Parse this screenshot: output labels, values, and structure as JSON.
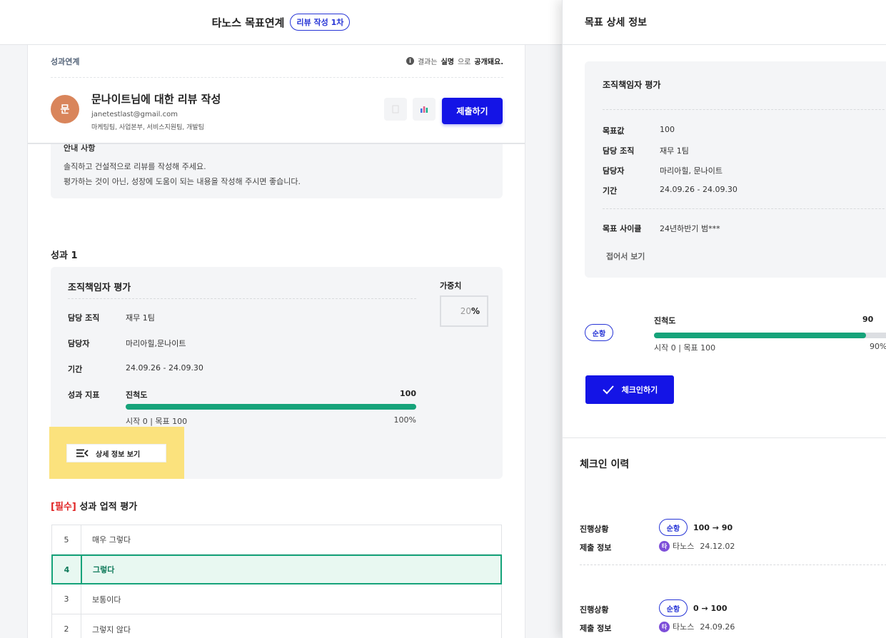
{
  "header": {
    "title": "타노스 목표연계",
    "badge": "리뷰 작성 1차"
  },
  "review": {
    "crumb": "성과연계",
    "notice_pre": "결과는",
    "notice_bold1": "실명",
    "notice_mid": "으로",
    "notice_bold2": "공개돼요.",
    "avatar": "문",
    "title": "문나이트님에 대한 리뷰 작성",
    "email": "janetestlast@gmail.com",
    "teams": "마케팅팀, 사업본부, 서비스지원팀, 개발팀",
    "submit_label": "제출하기"
  },
  "guide": {
    "title": "안내 사항",
    "lines": [
      "솔직하고 건설적으로 리뷰를 작성해 주세요.",
      "평가하는 것이 아닌, 성장에 도움이 되는 내용을 작성해 주시면 좋습니다."
    ]
  },
  "perf": {
    "section": "성과 1",
    "card_title": "조직책임자 평가",
    "weight_label": "가중치",
    "weight_value": "20",
    "weight_unit": "%",
    "rows": [
      {
        "key": "담당 조직",
        "value": "재무 1팀"
      },
      {
        "key": "담당자",
        "value": "마리아힐,문나이트"
      },
      {
        "key": "기간",
        "value": "24.09.26 - 24.09.30"
      }
    ],
    "metric_key": "성과 지표",
    "metric_name": "진척도",
    "metric_value": "100",
    "metric_progress": 1.0,
    "metric_sub": "시작 0 | 목표 100",
    "metric_pct": "100%",
    "detail_btn": "상세 정보 보기"
  },
  "rating": {
    "req": "[필수]",
    "title": "성과 업적 평가",
    "options": [
      {
        "num": "5",
        "label": "매우 그렇다",
        "selected": false
      },
      {
        "num": "4",
        "label": "그렇다",
        "selected": true
      },
      {
        "num": "3",
        "label": "보통이다",
        "selected": false
      },
      {
        "num": "2",
        "label": "그렇지 않다",
        "selected": false
      }
    ]
  },
  "panel": {
    "title": "목표 상세 정보",
    "card_title": "조직책임자 평가",
    "rows": [
      {
        "key": "목표값",
        "value": "100"
      },
      {
        "key": "담당 조직",
        "value": "재무 1팀"
      },
      {
        "key": "담당자",
        "value": "마리아힐, 문나이트"
      },
      {
        "key": "기간",
        "value": "24.09.26 - 24.09.30"
      }
    ],
    "cycle_key": "목표 사이클",
    "cycle_value": "24년하반기 범***",
    "fold": "접어서 보기",
    "status_chip": "순항",
    "prog_name": "진척도",
    "prog_value": "90",
    "prog_fraction": 0.9,
    "prog_sub": "시작 0 | 목표 100",
    "prog_pct": "90%",
    "checkin_label": "체크인하기",
    "history_title": "체크인 이력",
    "history": [
      {
        "status_key": "진행상황",
        "chip": "순항",
        "change": "100 → 90",
        "submit_key": "제출 정보",
        "avatar": "타",
        "who": "타노스",
        "date": "24.12.02"
      },
      {
        "status_key": "진행상황",
        "chip": "순항",
        "change": "0 → 100",
        "submit_key": "제출 정보",
        "avatar": "타",
        "who": "타노스",
        "date": "24.09.26"
      }
    ]
  },
  "colors": {
    "accent": "#1414e6",
    "progress": "#16a37a",
    "highlight": "#fbe27d",
    "required": "#e02424"
  }
}
